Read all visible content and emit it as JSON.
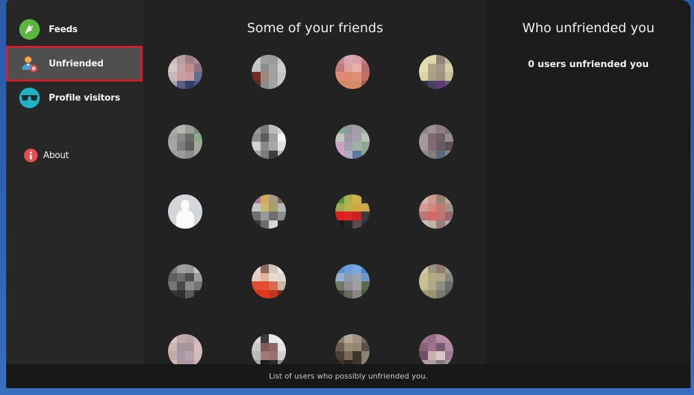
{
  "sidebar": {
    "items": [
      {
        "id": "feeds",
        "label": "Feeds",
        "icon": "feeds-icon",
        "color": "#5bb53f",
        "active": false
      },
      {
        "id": "unfriended",
        "label": "Unfriended",
        "icon": "unfriended-user-icon",
        "color": "#e0484b",
        "active": true
      },
      {
        "id": "profile-visitors",
        "label": "Profile visitors",
        "icon": "sunglasses-icon",
        "color": "#1fb2c4",
        "active": false
      },
      {
        "id": "about",
        "label": "About",
        "icon": "info-icon",
        "color": "#e94c4c",
        "active": false
      }
    ],
    "highlight_color": "#d21f2b"
  },
  "friends": {
    "title": "Some of your friends",
    "avatars": [
      {
        "colors": [
          "#cbbcc0",
          "#b79ea2",
          "#9c7f87",
          "#a98e98",
          "#d6c7c9",
          "#c4a5a7",
          "#c08d90",
          "#8e7080",
          "#c7b8bc",
          "#c8a0a0",
          "#c89aa0",
          "#607090",
          "#a7a6b6",
          "#5a5f80",
          "#33406a",
          "#4a5888"
        ]
      },
      {
        "colors": [
          "#c9c9c9",
          "#9d9d9d",
          "#9a9a9a",
          "#c5c5c5",
          "#c4c4c4",
          "#8e8e8e",
          "#a3a3a3",
          "#d0d0d0",
          "#6f2c25",
          "#a08878",
          "#a0a0a0",
          "#c6c6c6",
          "#5a2a22",
          "#8d8d8d",
          "#a5a5a5",
          "#c9c9c9"
        ]
      },
      {
        "colors": [
          "#c88a8e",
          "#d8a6ae",
          "#d7a2a6",
          "#c07c80",
          "#c67a78",
          "#dca3a3",
          "#e6b1ad",
          "#b86e6c",
          "#e28c78",
          "#de8a6c",
          "#dd8e74",
          "#c07060",
          "#d58460",
          "#d88a68",
          "#d68a66",
          "#a85d4c"
        ]
      },
      {
        "colors": [
          "#e1dcaa",
          "#ddd6a6",
          "#8f857c",
          "#c6b8a0",
          "#e6dfb0",
          "#b2a48c",
          "#a89684",
          "#d7cfa6",
          "#dcd4a4",
          "#a89e8a",
          "#a09080",
          "#c9c09c",
          "#2c3048",
          "#4a4060",
          "#5a3b78",
          "#605878"
        ]
      },
      {
        "colors": [
          "#a7a9a5",
          "#b4b6b2",
          "#9a9c98",
          "#7e8a82",
          "#a2a4a0",
          "#8a8a8a",
          "#6a6a6a",
          "#8ea88a",
          "#a6a8a4",
          "#7e7e7e",
          "#5e5e5e",
          "#a4a8a0",
          "#98a49c",
          "#9a9a9a",
          "#8c8c8c",
          "#a6a8a2"
        ]
      },
      {
        "colors": [
          "#9a9a9a",
          "#777777",
          "#bdbdbd",
          "#cfcfcf",
          "#8c8c8c",
          "#5d5d5d",
          "#a0a0a0",
          "#f4f4f4",
          "#d2d2d2",
          "#8a8a8a",
          "#a8a8a8",
          "#e0e0e0",
          "#a5a5a5",
          "#7c7c7c",
          "#3e3e3e",
          "#b8b8b8"
        ]
      },
      {
        "colors": [
          "#7fae8c",
          "#8f9a9a",
          "#a29ea8",
          "#9db09e",
          "#c0c8c4",
          "#9c96a8",
          "#a6a0ae",
          "#b7c3b6",
          "#c8a2be",
          "#a39eae",
          "#9fb2a6",
          "#8fa894",
          "#d4a4c4",
          "#b1aac2",
          "#5b79a0",
          "#8aa692"
        ]
      },
      {
        "colors": [
          "#8a8286",
          "#a08e92",
          "#8c7c80",
          "#7a7076",
          "#a3989a",
          "#7e6a70",
          "#6e5e66",
          "#9a8a8e",
          "#a49a9c",
          "#806c72",
          "#6a5a62",
          "#5a5058",
          "#8a8a90",
          "#8a7a80",
          "#566a80",
          "#8a8088"
        ]
      },
      {
        "placeholder": true
      },
      {
        "colors": [
          "#b47a96",
          "#d1a85c",
          "#a99b84",
          "#706a60",
          "#c6c6c6",
          "#c8b86e",
          "#a8a06a",
          "#b8b8b8",
          "#6e6e6e",
          "#9a9a9a",
          "#6e6e6e",
          "#8e8e8e",
          "#3a3a3a",
          "#6c6c6c",
          "#d6d6d6",
          "#2a2a2a"
        ]
      },
      {
        "colors": [
          "#4d9a3c",
          "#aab04e",
          "#d0b24a",
          "#2e2e2e",
          "#a0a850",
          "#b4b44a",
          "#d0a840",
          "#cca84a",
          "#e01c1c",
          "#e02424",
          "#c82424",
          "#3c3c3c",
          "#1a1a1a",
          "#282828",
          "#5a4a50",
          "#2c3450"
        ]
      },
      {
        "colors": [
          "#cdb8b0",
          "#c89c90",
          "#9a8474",
          "#b6aaa0",
          "#d69a90",
          "#d28882",
          "#c07a70",
          "#a6908c",
          "#b2787c",
          "#d6686a",
          "#c4726e",
          "#946a70",
          "#c8c0bc",
          "#c2b2a4",
          "#9c7e7a",
          "#b2a8a4"
        ]
      },
      {
        "colors": [
          "#7b7b7b",
          "#a0a0a0",
          "#9a9a9a",
          "#c2c2c2",
          "#5e5e5e",
          "#6e6e6e",
          "#4e4e4e",
          "#9e9e9e",
          "#767676",
          "#4a4a4a",
          "#8a8a8a",
          "#767676",
          "#3a3a3a",
          "#2e2e2e",
          "#5a5a5a",
          "#2a2a2a"
        ]
      },
      {
        "colors": [
          "#e8d6cc",
          "#8a6a60",
          "#d4c6c0",
          "#f0e8e0",
          "#e8cec4",
          "#e4b0a0",
          "#e8dcd0",
          "#e0d8cc",
          "#e04c2c",
          "#e84a30",
          "#d86a50",
          "#c8b8a8",
          "#d8361c",
          "#e0391e",
          "#c23420",
          "#7a2a1a"
        ]
      },
      {
        "colors": [
          "#5c8fd4",
          "#6e9ede",
          "#78a6e0",
          "#4a80cc",
          "#92b0d2",
          "#8d9aaa",
          "#9aa4ae",
          "#6e96c6",
          "#6e7a62",
          "#8e8e94",
          "#a09ea0",
          "#5a6a50",
          "#3a4a30",
          "#6a6660",
          "#8a8682",
          "#4a5a40"
        ]
      },
      {
        "colors": [
          "#d2caa0",
          "#9c9484",
          "#8e7c70",
          "#a49c8c",
          "#c9c094",
          "#b4aa84",
          "#b2a488",
          "#8a8680",
          "#c6be92",
          "#b0aa84",
          "#8f8e82",
          "#6a7070",
          "#a09a6e",
          "#9a9270",
          "#7a7a70",
          "#5e6264"
        ]
      },
      {
        "colors": [
          "#d6c2c0",
          "#c5a9ad",
          "#b6a4aa",
          "#cab8bc",
          "#cfb6b6",
          "#a8969e",
          "#a8949a",
          "#d4bebe",
          "#c2a8aa",
          "#a79aa6",
          "#b6a2aa",
          "#d2bcbc",
          "#d0b8b4",
          "#b09898",
          "#a89aa2",
          "#ccb4b0"
        ]
      },
      {
        "colors": [
          "#d8d8d8",
          "#3c3c3c",
          "#e8e8e8",
          "#f0f0f0",
          "#c8c8c8",
          "#7e5a58",
          "#8a6a66",
          "#e4e4e4",
          "#bababa",
          "#a07a78",
          "#9a7270",
          "#d0d0d0",
          "#a4a4a4",
          "#1c1c1c",
          "#2a2a2a",
          "#8c8c8c"
        ]
      },
      {
        "colors": [
          "#8e806e",
          "#b4a898",
          "#a49484",
          "#7a6e60",
          "#6e5e50",
          "#9a8a76",
          "#968672",
          "#5a5044",
          "#4a4038",
          "#7a6858",
          "#3c342c",
          "#8c8272",
          "#3a3430",
          "#2c2622",
          "#3e3630",
          "#8a8274"
        ]
      },
      {
        "colors": [
          "#a0768a",
          "#9a7088",
          "#b48ca4",
          "#b690a8",
          "#8a6078",
          "#a0708c",
          "#7a5870",
          "#ae8aa2",
          "#6e4e66",
          "#c8b0b0",
          "#d8c8c4",
          "#9a7a92",
          "#b49cae",
          "#a8a0a8",
          "#7e7a80",
          "#a492a4"
        ]
      }
    ]
  },
  "unfriended": {
    "title": "Who unfriended you",
    "count_text": "0 users unfriended you"
  },
  "footer": {
    "text": "List of users who possibly unfriended you."
  }
}
